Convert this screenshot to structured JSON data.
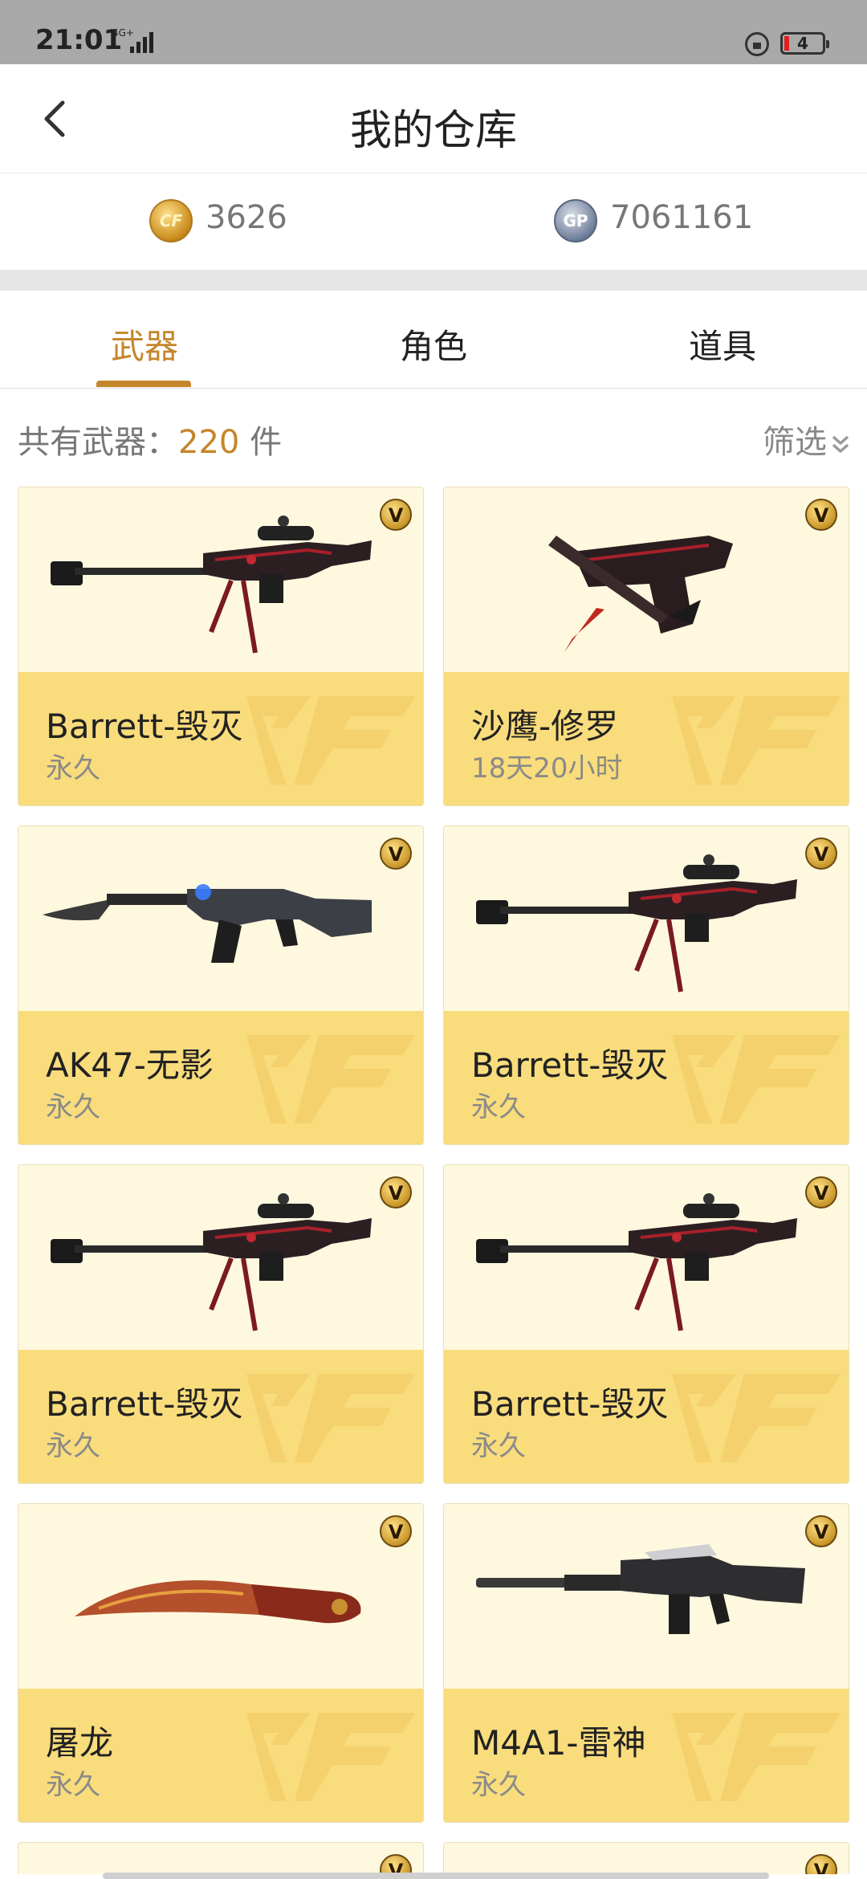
{
  "status_bar": {
    "time": "21:01",
    "network": "4G+",
    "battery": "4"
  },
  "header": {
    "title": "我的仓库"
  },
  "currency": {
    "cf_amount": "3626",
    "gp_amount": "7061161"
  },
  "tabs": [
    {
      "label": "武器",
      "active": true
    },
    {
      "label": "角色",
      "active": false
    },
    {
      "label": "道具",
      "active": false
    }
  ],
  "summary": {
    "count_prefix": "共有武器：",
    "count": "220",
    "count_suffix": " 件",
    "filter_label": "筛选"
  },
  "items": [
    {
      "name": "Barrett-毁灭",
      "duration": "永久",
      "weapon": "sniper-rifle"
    },
    {
      "name": "沙鹰-修罗",
      "duration": "18天20小时",
      "weapon": "pistol"
    },
    {
      "name": "AK47-无影",
      "duration": "永久",
      "weapon": "assault-rifle"
    },
    {
      "name": "Barrett-毁灭",
      "duration": "永久",
      "weapon": "sniper-rifle"
    },
    {
      "name": "Barrett-毁灭",
      "duration": "永久",
      "weapon": "sniper-rifle"
    },
    {
      "name": "Barrett-毁灭",
      "duration": "永久",
      "weapon": "sniper-rifle"
    },
    {
      "name": "屠龙",
      "duration": "永久",
      "weapon": "knife"
    },
    {
      "name": "M4A1-雷神",
      "duration": "永久",
      "weapon": "carbine"
    }
  ],
  "colors": {
    "accent": "#c4862b",
    "card_top": "#fef8de",
    "card_bottom": "#f9dc7c"
  }
}
